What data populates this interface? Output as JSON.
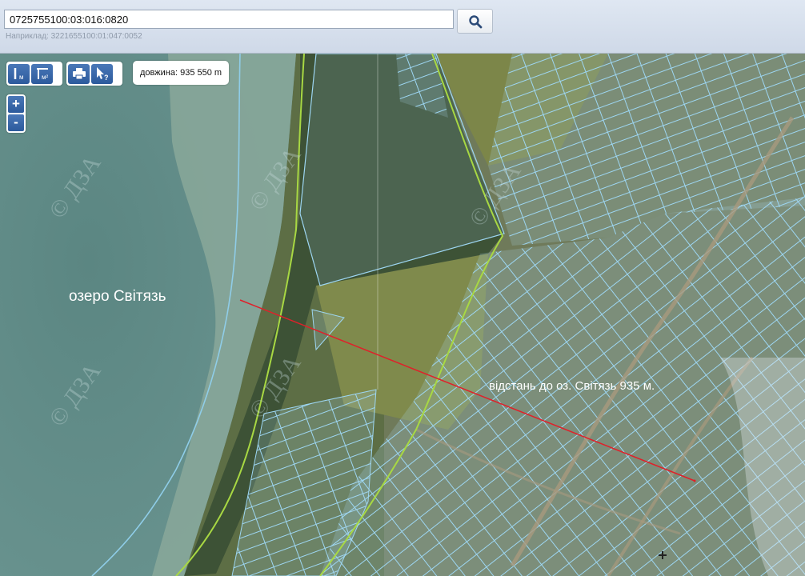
{
  "search": {
    "value": "0725755100:03:016:0820",
    "example": "Наприклад: 3221655100:01:047:0052"
  },
  "tools": {
    "measure_length_label": "м",
    "measure_area_label": "м²",
    "print_icon": "printer-icon",
    "info_icon": "cursor-question-icon",
    "zoom_in_label": "+",
    "zoom_out_label": "-"
  },
  "measurement": {
    "length_label": "довжина:",
    "length_value": "935 550 m"
  },
  "labels": {
    "lake": "озеро Світязь",
    "distance": "відстань до оз. Світязь 935 м."
  },
  "watermark": "© ДЗА",
  "colors": {
    "lake": "#5f8a86",
    "parcel_outline": "#8fd0f0",
    "boundary_line": "#a8d843",
    "measure_line": "#e0202a"
  }
}
